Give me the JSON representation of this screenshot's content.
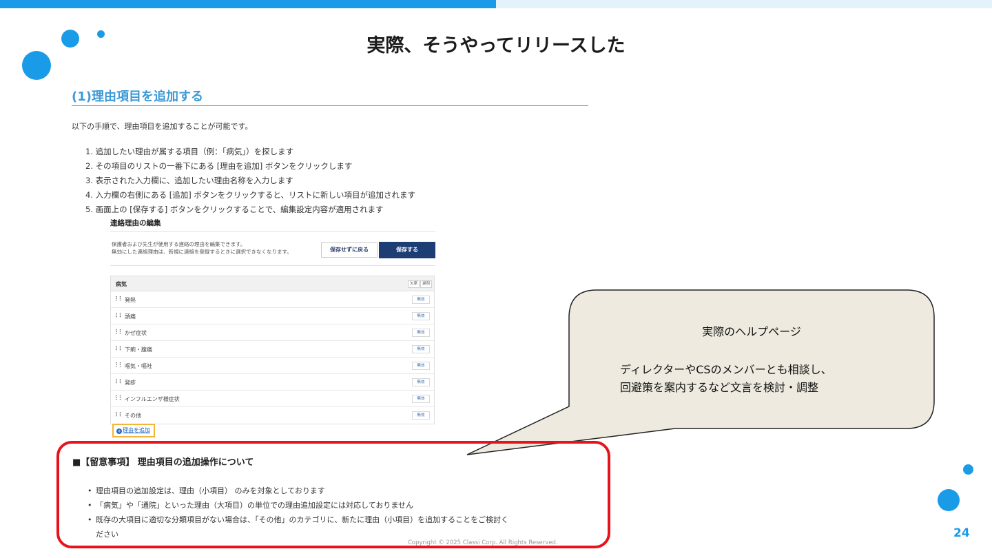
{
  "slide": {
    "title": "実際、そうやってリリースした",
    "page_number": "24",
    "copyright": "Copyright © 2025 Classi Corp. All Rights Reserved."
  },
  "help_page": {
    "heading": "(1)理由項目を追加する",
    "intro": "以下の手順で、理由項目を追加することが可能です。",
    "steps": [
      "1. 追加したい理由が属する項目（例：「病気」）を探します",
      "2. その項目のリストの一番下にある [理由を追加] ボタンをクリックします",
      "3. 表示された入力欄に、追加したい理由名称を入力します",
      "4. 入力欄の右側にある [追加] ボタンをクリックすると、リストに新しい項目が追加されます",
      "5. 画面上の [保存する] ボタンをクリックすることで、編集設定内容が適用されます"
    ]
  },
  "embedded_ui": {
    "title": "連絡理由の編集",
    "description_line1": "保護者および先生が使用する連絡の理由を編集できます。",
    "description_line2": "無効にした連絡理由は、新規に連絡を登録するときに選択できなくなります。",
    "back_button": "保存せずに戻る",
    "save_button": "保存する",
    "category": {
      "name": "病気",
      "tags": [
        "欠席",
        "遅刻"
      ],
      "items": [
        "発熱",
        "頭痛",
        "かぜ症状",
        "下痢・腹痛",
        "嘔気・嘔吐",
        "発疹",
        "インフルエンザ様症状",
        "その他"
      ],
      "disable_label": "無効"
    },
    "add_reason_link": "理由を追加"
  },
  "callout": {
    "title": "実際のヘルプページ",
    "line1": "ディレクターやCSのメンバーとも相談し、",
    "line2": "回避策を案内するなど文言を検討・調整"
  },
  "notice": {
    "heading": "■【留意事項】 理由項目の追加操作について",
    "items": [
      "理由項目の追加設定は、理由（小項目） のみを対象としております",
      "「病気」や「通院」といった理由（大項目）の単位での理由追加設定には対応しておりません",
      "既存の大項目に適切な分類項目がない場合は、「その他」のカテゴリに、新たに理由（小項目）を追加することをご検討く"
    ],
    "item3_continued": "ださい"
  },
  "colors": {
    "accent": "#1a9be8",
    "heading_blue": "#3c9ad6",
    "highlight_red": "#e8121a",
    "callout_fill": "#eeeadf",
    "save_button_navy": "#1e3d75"
  }
}
